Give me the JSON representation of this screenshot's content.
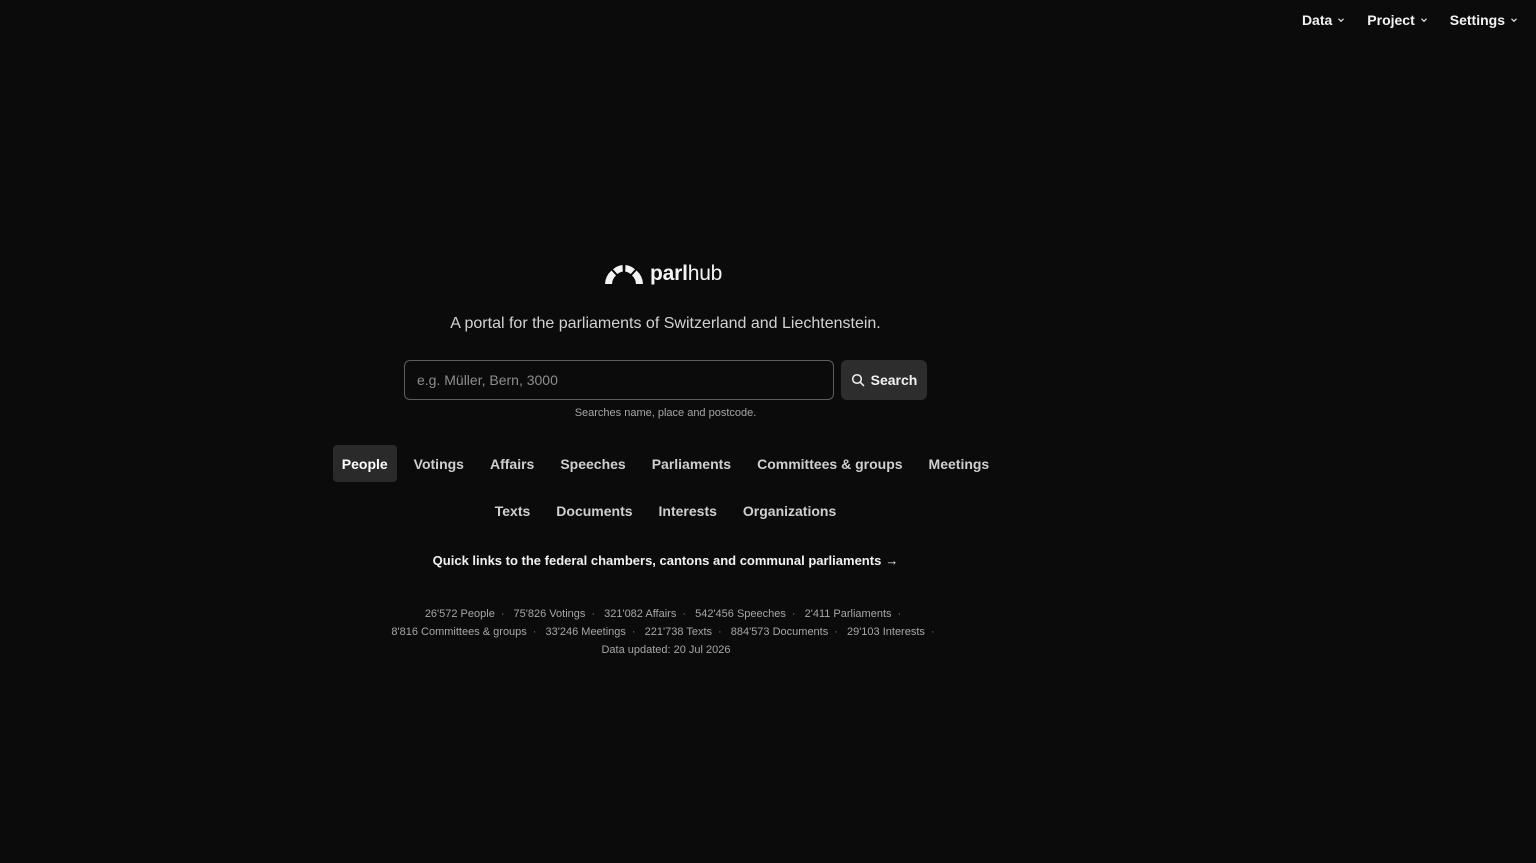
{
  "nav": {
    "items": [
      {
        "label": "Data"
      },
      {
        "label": "Project"
      },
      {
        "label": "Settings"
      }
    ]
  },
  "logo": {
    "text_bold": "parl",
    "text_light": "hub",
    "icon": "parliament-arc-icon"
  },
  "tagline": "A portal for the parliaments of Switzerland and Liechtenstein.",
  "search": {
    "placeholder": "e.g. Müller, Bern, 3000",
    "value": "",
    "button_label": "Search",
    "hint": "Searches name, place and postcode."
  },
  "tabs": {
    "row1": [
      {
        "label": "People",
        "active": true
      },
      {
        "label": "Votings"
      },
      {
        "label": "Affairs"
      },
      {
        "label": "Speeches"
      },
      {
        "label": "Parliaments"
      },
      {
        "label": "Committees & groups"
      },
      {
        "label": "Meetings"
      }
    ],
    "row2": [
      {
        "label": "Texts"
      },
      {
        "label": "Documents"
      },
      {
        "label": "Interests"
      },
      {
        "label": "Organizations"
      }
    ]
  },
  "quick_link": {
    "label": "Quick links to the federal chambers, cantons and communal parliaments",
    "arrow": "→"
  },
  "stats": {
    "separator": "·",
    "items": [
      "26'572 People",
      "75'826 Votings",
      "321'082 Affairs",
      "542'456 Speeches",
      "2'411 Parliaments",
      "8'816 Committees & groups",
      "33'246 Meetings",
      "221'738 Texts",
      "884'573 Documents",
      "29'103 Interests",
      "Data updated: 20 Jul 2026"
    ]
  },
  "colors": {
    "background": "#0b0b0b",
    "active_tab_bg": "#2a2a2a",
    "button_bg": "#2d2d2d",
    "input_border": "#5e5e5e"
  }
}
